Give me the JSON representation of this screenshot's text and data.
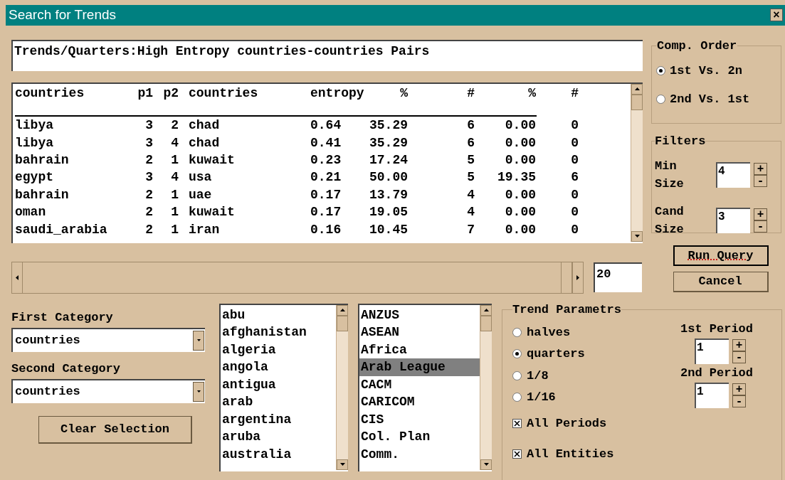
{
  "window": {
    "title": "Search for Trends",
    "close": "×"
  },
  "query_title": "Trends/Quarters:High Entropy countries-countries Pairs",
  "table": {
    "columns": [
      "countries",
      "p1",
      "p2",
      "countries",
      "entropy",
      "%",
      "#",
      "%",
      "#"
    ],
    "rows": [
      [
        "libya",
        "3",
        "2",
        "chad",
        "0.64",
        "35.29",
        "6",
        "0.00",
        "0"
      ],
      [
        "libya",
        "3",
        "4",
        "chad",
        "0.41",
        "35.29",
        "6",
        "0.00",
        "0"
      ],
      [
        "bahrain",
        "2",
        "1",
        "kuwait",
        "0.23",
        "17.24",
        "5",
        "0.00",
        "0"
      ],
      [
        "egypt",
        "3",
        "4",
        "usa",
        "0.21",
        "50.00",
        "5",
        "19.35",
        "6"
      ],
      [
        "bahrain",
        "2",
        "1",
        "uae",
        "0.17",
        "13.79",
        "4",
        "0.00",
        "0"
      ],
      [
        "oman",
        "2",
        "1",
        "kuwait",
        "0.17",
        "19.05",
        "4",
        "0.00",
        "0"
      ],
      [
        "saudi_arabia",
        "2",
        "1",
        "iran",
        "0.16",
        "10.45",
        "7",
        "0.00",
        "0"
      ]
    ]
  },
  "row_slider": {
    "level": 1,
    "value": "20"
  },
  "comp_order": {
    "title": "Comp. Order",
    "options": [
      {
        "label": "1st Vs. 2n",
        "selected": true
      },
      {
        "label": "2nd Vs. 1st",
        "selected": false
      }
    ]
  },
  "filters": {
    "title": "Filters",
    "fields": [
      {
        "label": "Min Size",
        "value": "4",
        "plus": "+",
        "minus": "-"
      },
      {
        "label": "Cand Size",
        "value": "3",
        "plus": "+",
        "minus": "-"
      }
    ]
  },
  "buttons": [
    {
      "label": "Run Query",
      "default": true
    },
    {
      "label": "Cancel",
      "default": false
    }
  ],
  "categories": [
    {
      "label": "First Category",
      "value": "countries"
    },
    {
      "label": "Second Category",
      "value": "countries"
    }
  ],
  "clear_button": "Clear Selection",
  "entity_list": [
    {
      "label": "abu",
      "selected": false
    },
    {
      "label": "afghanistan",
      "selected": false
    },
    {
      "label": "algeria",
      "selected": false
    },
    {
      "label": "angola",
      "selected": false
    },
    {
      "label": "antigua",
      "selected": false
    },
    {
      "label": "arab",
      "selected": false
    },
    {
      "label": "argentina",
      "selected": false
    },
    {
      "label": "aruba",
      "selected": false
    },
    {
      "label": "australia",
      "selected": false
    }
  ],
  "group_list": [
    {
      "label": "ANZUS",
      "selected": false
    },
    {
      "label": "ASEAN",
      "selected": false
    },
    {
      "label": "Africa",
      "selected": false
    },
    {
      "label": "Arab League",
      "selected": true
    },
    {
      "label": "CACM",
      "selected": false
    },
    {
      "label": "CARICOM",
      "selected": false
    },
    {
      "label": "CIS",
      "selected": false
    },
    {
      "label": "Col. Plan",
      "selected": false
    },
    {
      "label": "Comm.",
      "selected": false
    }
  ],
  "trend_parameters": {
    "title": "Trend Parametrs",
    "granularity": [
      {
        "label": "halves",
        "selected": false
      },
      {
        "label": "quarters",
        "selected": true
      },
      {
        "label": "1/8",
        "selected": false
      },
      {
        "label": "1/16",
        "selected": false
      }
    ],
    "options": [
      {
        "label": "All Periods",
        "checked": true
      },
      {
        "label": "All Entities",
        "checked": true
      }
    ],
    "periods": [
      {
        "label": "1st Period",
        "value": "1",
        "plus": "+",
        "minus": "-"
      },
      {
        "label": "2nd Period",
        "value": "1",
        "plus": "+",
        "minus": "-"
      }
    ]
  }
}
